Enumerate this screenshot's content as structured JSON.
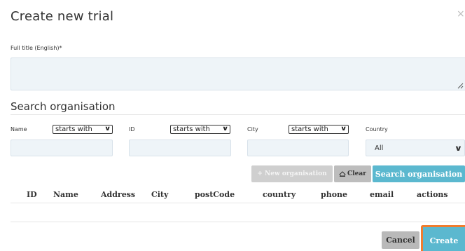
{
  "dialog": {
    "title": "Create new trial",
    "close_glyph": "×"
  },
  "full_title": {
    "label": "Full title (English)*",
    "value": ""
  },
  "search": {
    "heading": "Search organisation",
    "filters": {
      "name_label": "Name",
      "name_mode": "starts with",
      "id_label": "ID",
      "id_mode": "starts with",
      "city_label": "City",
      "city_mode": "starts with",
      "country_label": "Country",
      "country_value": "All"
    },
    "buttons": {
      "new_org": "+ New organisation",
      "clear": "Clear",
      "search": "Search organisation"
    }
  },
  "table": {
    "columns": [
      "ID",
      "Name",
      "Address",
      "City",
      "postCode",
      "country",
      "phone",
      "email",
      "actions"
    ]
  },
  "footer": {
    "cancel": "Cancel",
    "create": "Create"
  },
  "colors": {
    "accent": "#5bb8cf",
    "focus_outline": "#f07c2e",
    "disabled_button": "#cfcfcf",
    "cancel_button": "#b9b9b9",
    "input_bg": "#eef4f8"
  },
  "icons": {
    "close": "close-icon",
    "chevron": "chevron-down-icon",
    "eraser": "eraser-icon",
    "resize": "resize-grip-icon"
  }
}
